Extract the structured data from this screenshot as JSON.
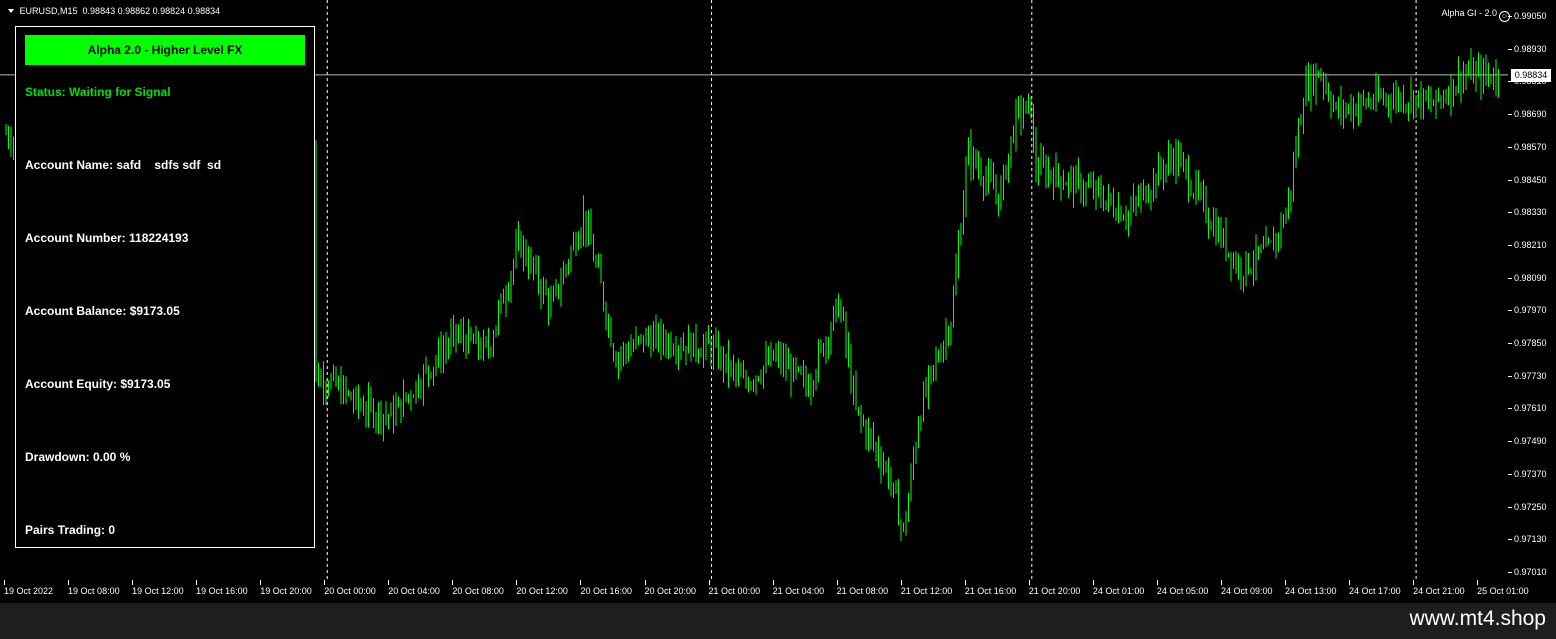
{
  "header": {
    "symbol": "EURUSD,M15",
    "ohlc": "0.98843 0.98862 0.98824 0.98834",
    "indicator": "Alpha GI - 2.0"
  },
  "panel": {
    "title": "Alpha 2.0 - Higher Level FX",
    "status": "Status: Waiting for Signal",
    "account_name": "Account Name: safd    sdfs sdf  sd",
    "account_number": "Account Number: 118224193",
    "account_balance": "Account Balance: $9173.05",
    "account_equity": "Account Equity: $9173.05",
    "drawdown": "Drawdown: 0.00 %",
    "pairs_trading": "Pairs Trading: 0"
  },
  "price_scale": {
    "labels": [
      "0.99050",
      "0.98930",
      "0.98810",
      "0.98690",
      "0.98570",
      "0.98450",
      "0.98330",
      "0.98210",
      "0.98090",
      "0.97970",
      "0.97850",
      "0.97730",
      "0.97610",
      "0.97490",
      "0.97370",
      "0.97250",
      "0.97130",
      "0.97010"
    ],
    "current_price": "0.98834"
  },
  "time_scale": {
    "labels": [
      "19 Oct 2022",
      "19 Oct 08:00",
      "19 Oct 12:00",
      "19 Oct 16:00",
      "19 Oct 20:00",
      "20 Oct 00:00",
      "20 Oct 04:00",
      "20 Oct 08:00",
      "20 Oct 12:00",
      "20 Oct 16:00",
      "20 Oct 20:00",
      "21 Oct 00:00",
      "21 Oct 04:00",
      "21 Oct 08:00",
      "21 Oct 12:00",
      "21 Oct 16:00",
      "21 Oct 20:00",
      "24 Oct 01:00",
      "24 Oct 05:00",
      "24 Oct 09:00",
      "24 Oct 13:00",
      "24 Oct 17:00",
      "24 Oct 21:00",
      "25 Oct 01:00"
    ]
  },
  "chart_data": {
    "type": "candlestick",
    "symbol": "EURUSD",
    "timeframe": "M15",
    "ylim": [
      0.9701,
      0.9905
    ],
    "current_price": 0.98834,
    "day_separators": [
      "20 Oct 00:00",
      "21 Oct 00:00",
      "21 Oct 20:00",
      "24 Oct 21:00"
    ],
    "close_path": [
      [
        "19 Oct 2022",
        0.9862
      ],
      [
        "19 Oct 20:00",
        0.9774
      ],
      [
        "20 Oct 00:00",
        0.9772
      ],
      [
        "20 Oct 02:00",
        0.9762
      ],
      [
        "20 Oct 04:00",
        0.9758
      ],
      [
        "20 Oct 08:00",
        0.9788
      ],
      [
        "20 Oct 10:00",
        0.9782
      ],
      [
        "20 Oct 12:00",
        0.9822
      ],
      [
        "20 Oct 14:00",
        0.9798
      ],
      [
        "20 Oct 16:00",
        0.9832
      ],
      [
        "20 Oct 17:00",
        0.9808
      ],
      [
        "20 Oct 18:00",
        0.978
      ],
      [
        "20 Oct 20:00",
        0.9787
      ],
      [
        "21 Oct 00:00",
        0.9783
      ],
      [
        "21 Oct 02:00",
        0.977
      ],
      [
        "21 Oct 04:00",
        0.978
      ],
      [
        "21 Oct 06:00",
        0.9769
      ],
      [
        "21 Oct 08:00",
        0.98
      ],
      [
        "21 Oct 09:00",
        0.976
      ],
      [
        "21 Oct 11:00",
        0.9738
      ],
      [
        "21 Oct 12:00",
        0.9715
      ],
      [
        "21 Oct 13:00",
        0.976
      ],
      [
        "21 Oct 15:00",
        0.9795
      ],
      [
        "21 Oct 16:00",
        0.9855
      ],
      [
        "21 Oct 18:00",
        0.9838
      ],
      [
        "21 Oct 19:00",
        0.9868
      ],
      [
        "21 Oct 20:00",
        0.9872
      ],
      [
        "21 Oct 22:00",
        0.985
      ],
      [
        "24 Oct 01:00",
        0.984
      ],
      [
        "24 Oct 03:00",
        0.9832
      ],
      [
        "24 Oct 05:00",
        0.9848
      ],
      [
        "24 Oct 06:00",
        0.9854
      ],
      [
        "24 Oct 08:00",
        0.9832
      ],
      [
        "24 Oct 10:00",
        0.9812
      ],
      [
        "24 Oct 12:00",
        0.982
      ],
      [
        "24 Oct 13:00",
        0.9835
      ],
      [
        "24 Oct 14:00",
        0.9878
      ],
      [
        "24 Oct 15:00",
        0.9885
      ],
      [
        "24 Oct 16:00",
        0.987
      ],
      [
        "24 Oct 19:00",
        0.9875
      ],
      [
        "24 Oct 21:00",
        0.9875
      ],
      [
        "24 Oct 22:00",
        0.9872
      ],
      [
        "25 Oct 00:00",
        0.9884
      ],
      [
        "25 Oct 01:00",
        0.9883
      ]
    ]
  },
  "footer": {
    "watermark": "www.mt4.shop"
  }
}
